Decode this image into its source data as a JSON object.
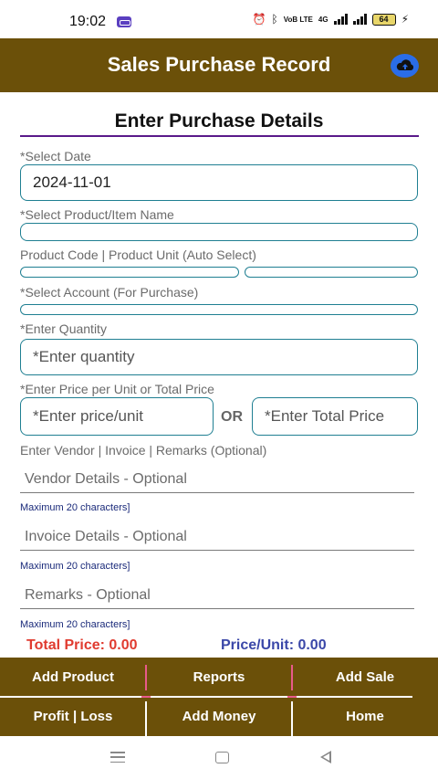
{
  "status_bar": {
    "time": "19:02",
    "network_label": "VoB LTE",
    "network_type": "4G",
    "battery": "64"
  },
  "app_bar": {
    "title": "Sales Purchase Record",
    "upload_icon": "cloud-upload-icon"
  },
  "form": {
    "section_title": "Enter Purchase Details",
    "date_label": "*Select Date",
    "date_value": "2024-11-01",
    "product_label": "*Select Product/Item Name",
    "product_value": "",
    "code_unit_label": "Product Code | Product Unit (Auto Select)",
    "product_code_value": "",
    "product_unit_value": "",
    "account_label": "*Select Account (For Purchase)",
    "account_value": "",
    "quantity_label": "*Enter Quantity",
    "quantity_placeholder": "*Enter quantity",
    "price_label": "*Enter Price per Unit or Total Price",
    "price_unit_placeholder": "*Enter price/unit",
    "or_text": "OR",
    "total_price_placeholder": "*Enter Total Price",
    "optional_label": "Enter Vendor | Invoice | Remarks (Optional)",
    "vendor_placeholder": "Vendor Details - Optional",
    "vendor_helper": "Maximum 20 characters]",
    "invoice_placeholder": "Invoice Details - Optional",
    "invoice_helper": "Maximum 20 characters]",
    "remarks_placeholder": "Remarks - Optional",
    "remarks_helper": "Maximum 20 characters]"
  },
  "summary": {
    "total_price": "Total Price: 0.00",
    "price_per_unit": "Price/Unit: 0.00"
  },
  "bottom_menu": {
    "add_product": "Add Product",
    "reports": "Reports",
    "add_sale": "Add Sale",
    "profit_loss": "Profit | Loss",
    "add_money": "Add Money",
    "home": "Home"
  },
  "colors": {
    "app_bar": "#6b5009",
    "field_border": "#1f7f92",
    "total_price": "#e03b2f",
    "unit_price": "#3a47a8",
    "upload_button": "#2a6de8"
  }
}
